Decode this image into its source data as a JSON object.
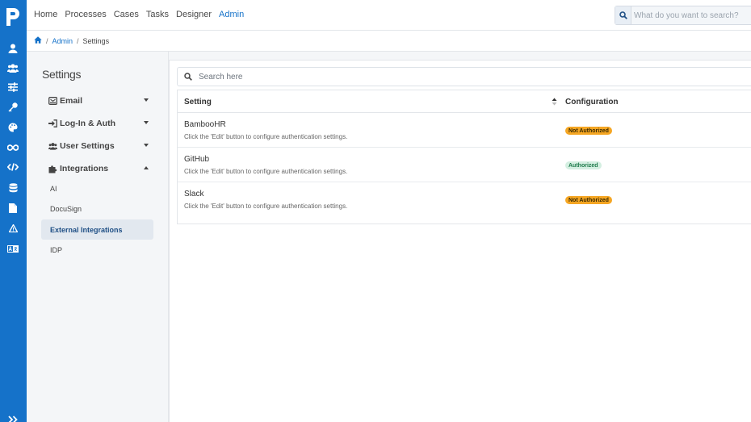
{
  "topnav": {
    "links": [
      "Home",
      "Processes",
      "Cases",
      "Tasks",
      "Designer",
      "Admin"
    ],
    "active": "Admin",
    "search_placeholder": "What do you want to search?"
  },
  "breadcrumb": {
    "items": [
      "Admin",
      "Settings"
    ]
  },
  "rail_icons": [
    "user-icon",
    "users-icon",
    "sliders-icon",
    "key-icon",
    "palette-icon",
    "infinity-icon",
    "code-icon",
    "database-icon",
    "file-icon",
    "warning-icon",
    "translate-icon",
    "expand-icon"
  ],
  "settings": {
    "title": "Settings",
    "groups": [
      {
        "label": "Email",
        "icon": "envelope-icon",
        "expanded": false
      },
      {
        "label": "Log-In & Auth",
        "icon": "sign-in-icon",
        "expanded": false
      },
      {
        "label": "User Settings",
        "icon": "users-icon",
        "expanded": false
      },
      {
        "label": "Integrations",
        "icon": "puzzle-icon",
        "expanded": true
      }
    ],
    "subitems": [
      "AI",
      "DocuSign",
      "External Integrations",
      "IDP"
    ],
    "active_subitem": "External Integrations"
  },
  "main": {
    "search_placeholder": "Search here",
    "columns": [
      "Setting",
      "Configuration"
    ],
    "rows": [
      {
        "name": "BambooHR",
        "description": "Click the 'Edit' button to configure authentication settings.",
        "status": "Not Authorized",
        "status_color": "#f5a623"
      },
      {
        "name": "GitHub",
        "description": "Click the 'Edit' button to configure authentication settings.",
        "status": "Authorized",
        "status_color": "#d4efe1"
      },
      {
        "name": "Slack",
        "description": "Click the 'Edit' button to configure authentication settings.",
        "status": "Not Authorized",
        "status_color": "#f5a623"
      }
    ]
  },
  "colors": {
    "brand": "#1572c9",
    "warning": "#f5a623",
    "success_bg": "#d4efe1"
  }
}
